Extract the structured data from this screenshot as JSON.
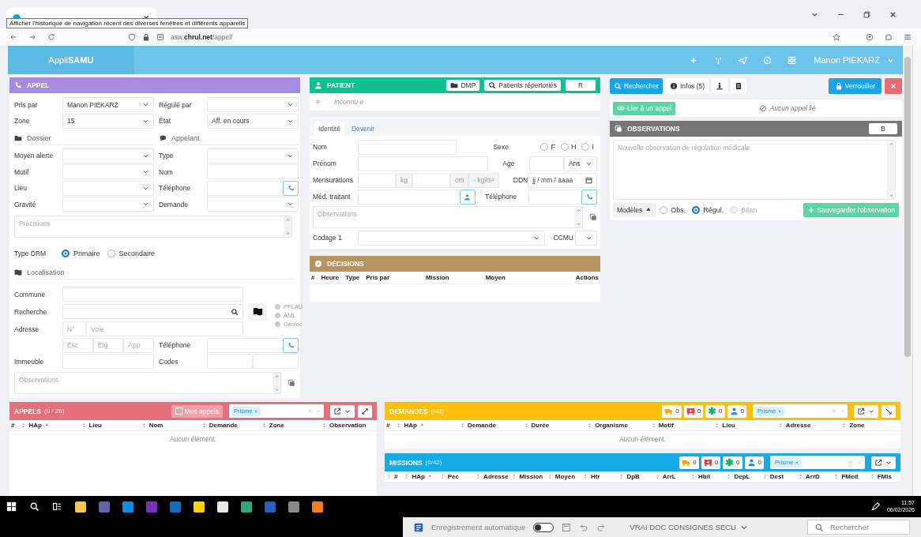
{
  "browser": {
    "tooltip": "Afficher l'historique de navigation récent des diverses fenêtres et différents appareils",
    "url": "asw.**chrul.net**/appel/"
  },
  "header": {
    "logo": "Appli**SAMU**",
    "user": "Manon PIEKARZ"
  },
  "appel": {
    "title": "APPEL",
    "top": [
      {
        "label": "Pris par",
        "kind": "select",
        "value": "Manon PIEKARZ"
      },
      {
        "label": "Régulé par",
        "kind": "select"
      },
      {
        "label": "Zone",
        "kind": "select",
        "value": "15"
      },
      {
        "label": "État",
        "kind": "select",
        "value": "Aff. en cours"
      }
    ],
    "dossier": {
      "title": "Dossier",
      "fields": [
        {
          "label": "Moyen alerte",
          "kind": "select"
        },
        {
          "label": "Motif",
          "kind": "select"
        },
        {
          "label": "Lieu",
          "kind": "select"
        },
        {
          "label": "Gravité",
          "kind": "select"
        }
      ]
    },
    "appelant": {
      "title": "Appelant",
      "fields": [
        {
          "label": "Type",
          "kind": "select"
        },
        {
          "label": "Nom",
          "kind": "input"
        },
        {
          "label": "Téléphone",
          "kind": "phone"
        },
        {
          "label": "Demande",
          "kind": "select"
        }
      ]
    },
    "precisions": {
      "placeholder": "Précisions"
    },
    "type_drm": {
      "label": "Type DRM",
      "options": [
        {
          "label": "Primaire",
          "selected": true
        },
        {
          "label": "Secondaire",
          "selected": false
        }
      ]
    },
    "localisation": {
      "title": "Localisation",
      "commune": "Commune",
      "recherche": "Recherche",
      "adresse": "Adresse",
      "adresse_parts": [
        {
          "placeholder": "N°"
        },
        {
          "placeholder": "Voie"
        }
      ],
      "detail_parts": [
        {
          "placeholder": "Esc"
        },
        {
          "placeholder": "Etg"
        },
        {
          "placeholder": "App"
        }
      ],
      "geo": [
        {
          "label": "PFLAU",
          "on": false
        },
        {
          "label": "AML",
          "on": false
        },
        {
          "label": "Géoloc",
          "on": false
        }
      ],
      "telephone": "Téléphone",
      "immeuble": "Immeuble",
      "codes": "Codes",
      "observations": {
        "placeholder": "Observations"
      }
    }
  },
  "patient": {
    "title": "PATIENT",
    "buttons": [
      {
        "label": "DMP",
        "kind": "folder"
      },
      {
        "label": "Patients répertoriés",
        "kind": "search"
      },
      {
        "label": "R",
        "kind": "plain"
      }
    ],
    "id_mark": "#",
    "identity": "Inconnu·e",
    "tabs": [
      {
        "label": "Identité",
        "selected": true
      },
      {
        "label": "Devenir",
        "selected": false
      }
    ],
    "nom": "Nom",
    "sexe": {
      "label": "Sexe",
      "options": [
        {
          "label": "F",
          "selected": false
        },
        {
          "label": "H",
          "selected": false
        },
        {
          "label": "I",
          "selected": false
        }
      ]
    },
    "prenom": "Prénom",
    "age": {
      "label": "Age",
      "unit": "Ans"
    },
    "mensurations": {
      "label": "Mensurations",
      "units": [
        "kg",
        "cm",
        "- kg/m²"
      ]
    },
    "ddn": {
      "label": "DDN",
      "placeholder": "jj / mm / aaaa"
    },
    "medecin": "Méd. traitant",
    "telephone": "Téléphone",
    "observations": {
      "placeholder": "Observations"
    },
    "codage": "Codage 1",
    "ccmu": "CCMU"
  },
  "decisions": {
    "title": "DÉCISIONS",
    "columns": [
      "#",
      "Heure",
      "Type",
      "Pris par",
      "Mission",
      "Moyen",
      "Actions"
    ]
  },
  "actions": {
    "search": "Rechercher",
    "infos": "Infos (5)",
    "lock": "Verrouiller",
    "link": "Lier à un appel",
    "link_status": "Aucun appel lié"
  },
  "observations": {
    "title": "OBSERVATIONS",
    "button": "B",
    "placeholder": "Nouvelle observation de régulation médicale",
    "templates": "Modèles",
    "types": [
      {
        "label": "Obs.",
        "selected": false,
        "disabled": false
      },
      {
        "label": "Régul.",
        "selected": true,
        "disabled": false
      },
      {
        "label": "Bilan",
        "selected": false,
        "disabled": true
      }
    ],
    "save": "Sauvegarder l'observation"
  },
  "appels": {
    "title": "APPELS",
    "count": "(0 / 26)",
    "mine": {
      "label": "Mes appels",
      "checked": false
    },
    "filter": "Prisme",
    "columns": [
      {
        "label": "#",
        "sortable": false,
        "sorted": false
      },
      {
        "label": "HAp",
        "sortable": true,
        "sorted": true
      },
      {
        "label": "Lieu",
        "sortable": true,
        "sorted": false
      },
      {
        "label": "Nom",
        "sortable": true,
        "sorted": false
      },
      {
        "label": "Demande",
        "sortable": true,
        "sorted": false
      },
      {
        "label": "Zone",
        "sortable": true,
        "sorted": false
      },
      {
        "label": "Observation",
        "sortable": true,
        "sorted": false
      }
    ],
    "empty": "Aucun élément."
  },
  "demandes": {
    "title": "DEMANDES",
    "count": "(0/3)",
    "counters": [
      {
        "kind": "vehicle",
        "count": "0",
        "color": "#f0a800"
      },
      {
        "kind": "ambulance",
        "count": "0",
        "color": "#e0404e"
      },
      {
        "kind": "medical",
        "count": "0",
        "color": "#19b36b"
      },
      {
        "kind": "person",
        "count": "0",
        "color": "#1e88e5"
      }
    ],
    "filter": "Prisme",
    "columns": [
      {
        "label": "#",
        "sortable": false,
        "sorted": false
      },
      {
        "label": "HAp",
        "sortable": true,
        "sorted": true
      },
      {
        "label": "Demande",
        "sortable": true,
        "sorted": false
      },
      {
        "label": "Durée",
        "sortable": true,
        "sorted": false
      },
      {
        "label": "Organisme",
        "sortable": true,
        "sorted": false
      },
      {
        "label": "Motif",
        "sortable": true,
        "sorted": false
      },
      {
        "label": "Lieu",
        "sortable": true,
        "sorted": false
      },
      {
        "label": "Adresse",
        "sortable": true,
        "sorted": false
      },
      {
        "label": "Zone",
        "sortable": true,
        "sorted": false
      }
    ],
    "empty": "Aucun élément."
  },
  "missions": {
    "title": "MISSIONS",
    "count": "(0/42)",
    "counters": [
      {
        "kind": "vehicle",
        "count": "0",
        "color": "#f0a800"
      },
      {
        "kind": "ambulance",
        "count": "0",
        "color": "#e0404e"
      },
      {
        "kind": "medical",
        "count": "0",
        "color": "#19b36b"
      },
      {
        "kind": "person",
        "count": "0",
        "color": "#1e88e5"
      }
    ],
    "filter": "Prisme",
    "columns": [
      {
        "label": "#",
        "sortable": true,
        "sorted": false
      },
      {
        "label": "HAp",
        "sortable": true,
        "sorted": true
      },
      {
        "label": "Pec",
        "sortable": true,
        "sorted": false
      },
      {
        "label": "Adresse",
        "sortable": true,
        "sorted": false
      },
      {
        "label": "Mission",
        "sortable": true,
        "sorted": false
      },
      {
        "label": "Moyen",
        "sortable": true,
        "sorted": false
      },
      {
        "label": "Htr",
        "sortable": true,
        "sorted": false
      },
      {
        "label": "DpB",
        "sortable": true,
        "sorted": false
      },
      {
        "label": "ArrL",
        "sortable": true,
        "sorted": false
      },
      {
        "label": "Hbil",
        "sortable": true,
        "sorted": false
      },
      {
        "label": "DepL",
        "sortable": true,
        "sorted": false
      },
      {
        "label": "Dest",
        "sortable": true,
        "sorted": false
      },
      {
        "label": "ArrD",
        "sortable": true,
        "sorted": false
      },
      {
        "label": "FMed",
        "sortable": true,
        "sorted": false
      },
      {
        "label": "FMis",
        "sortable": true,
        "sorted": false
      }
    ]
  },
  "taskbar": {
    "time": "11:57",
    "date": "06/02/2026"
  },
  "word": {
    "autosave": {
      "label": "Enregistrement automatique",
      "on": false
    },
    "document": "VRAI DOC CONSIGNES SECU",
    "search": "Rechercher"
  }
}
